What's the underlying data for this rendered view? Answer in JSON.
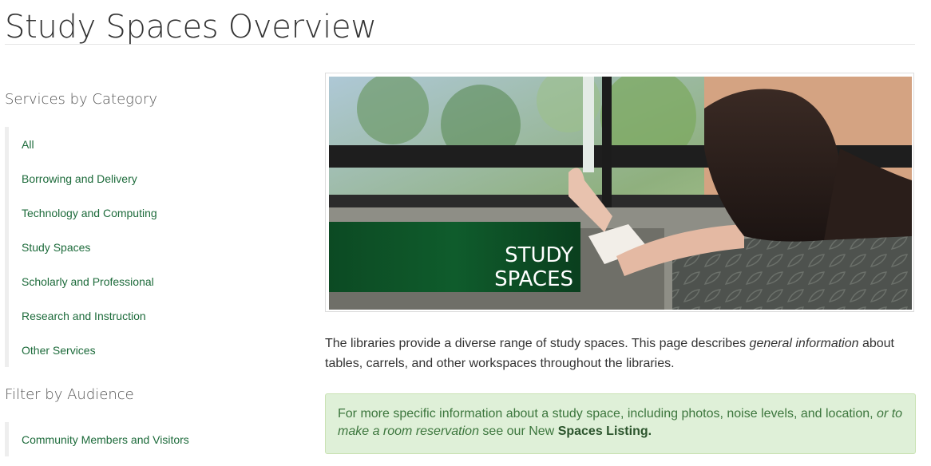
{
  "page": {
    "title": "Study Spaces Overview"
  },
  "sidebar": {
    "category_heading": "Services by Category",
    "categories": [
      {
        "label": "All"
      },
      {
        "label": "Borrowing and Delivery"
      },
      {
        "label": "Technology and Computing"
      },
      {
        "label": "Study Spaces"
      },
      {
        "label": "Scholarly and Professional"
      },
      {
        "label": "Research and Instruction"
      },
      {
        "label": "Other Services"
      }
    ],
    "audience_heading": "Filter by Audience",
    "audiences": [
      {
        "label": "Community Members and Visitors"
      }
    ]
  },
  "hero": {
    "overlay_line1": "STUDY",
    "overlay_line2": "SPACES"
  },
  "intro": {
    "text_before": "The libraries provide a diverse range of study spaces. This page describes ",
    "emphasis": "general information",
    "text_after": " about tables, carrels, and other workspaces throughout the libraries."
  },
  "callout": {
    "text_before": "For more specific information about a study space, including photos, noise levels, and location, ",
    "emphasis": "or to make a room reservation",
    "text_middle": " see our New ",
    "link_label": "Spaces Listing."
  },
  "colors": {
    "link": "#1d6b3b",
    "callout_bg": "#dff0d8",
    "callout_text": "#3c763d",
    "banner_green": "#0e5a2a"
  }
}
